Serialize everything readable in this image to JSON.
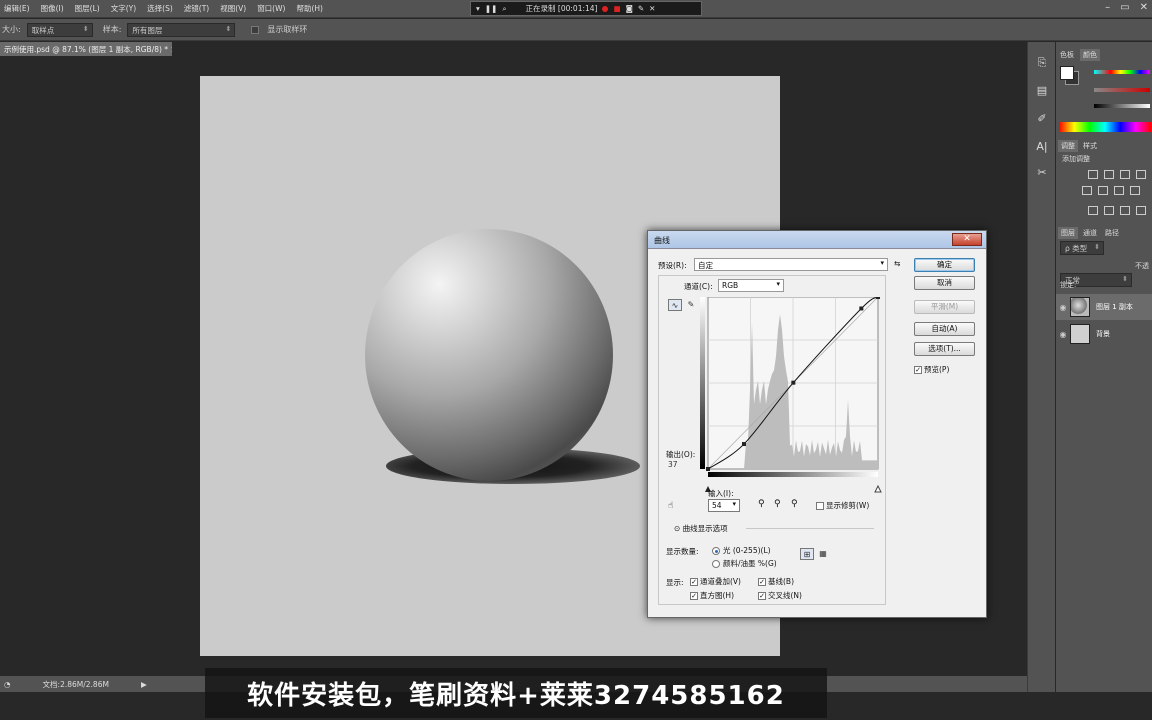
{
  "menubar": {
    "items": [
      "编辑(E)",
      "图像(I)",
      "图层(L)",
      "文字(Y)",
      "选择(S)",
      "滤镜(T)",
      "视图(V)",
      "窗口(W)",
      "帮助(H)"
    ]
  },
  "recorder": {
    "status": "正在录制 [00:01:14]"
  },
  "options_bar": {
    "size_label": "大小:",
    "size_value": "取样点",
    "sample_label": "样本:",
    "sample_value": "所有图层",
    "ring_label": "显示取样环"
  },
  "document": {
    "tab_title": "示例使用.psd @ 87.1% (图层 1 副本, RGB/8) *",
    "status_size": "文档:2.86M/2.86M"
  },
  "subtitle": "软件安装包，笔刷资料+莱莱3274585162",
  "right_panel": {
    "color_tabs": [
      "色板",
      "颜色"
    ],
    "adjust_tabs": [
      "调整",
      "样式"
    ],
    "adjust_title": "添加调整",
    "layers_tabs": [
      "图层",
      "通道",
      "路径"
    ],
    "kind_label": "ρ 类型",
    "blend_mode": "正常",
    "opacity_label": "不透",
    "lock_label": "锁定:",
    "layers": [
      {
        "name": "图层 1 副本",
        "selected": true
      },
      {
        "name": "背景",
        "selected": false
      }
    ]
  },
  "curves_dialog": {
    "title": "曲线",
    "preset_label": "预设(R):",
    "preset_value": "自定",
    "channel_label": "通道(C):",
    "channel_value": "RGB",
    "output_label": "输出(O):",
    "output_value": "37",
    "input_label": "输入(I):",
    "input_value": "54",
    "show_clipping_label": "显示修剪(W)",
    "display_options_label": "曲线显示选项",
    "show_amount_label": "显示数量:",
    "light_option": "光 (0-255)(L)",
    "pigment_option": "颜料/油墨 %(G)",
    "show_label": "显示:",
    "checks": [
      "通道叠加(V)",
      "基线(B)",
      "直方图(H)",
      "交叉线(N)"
    ],
    "buttons": {
      "ok": "确定",
      "cancel": "取消",
      "smooth": "平滑(M)",
      "auto": "自动(A)",
      "options": "选项(T)...",
      "preview": "预览(P)"
    },
    "curve_points": [
      {
        "input": 0,
        "output": 0
      },
      {
        "input": 54,
        "output": 37
      },
      {
        "input": 128,
        "output": 128
      },
      {
        "input": 230,
        "output": 238
      },
      {
        "input": 255,
        "output": 255
      }
    ]
  }
}
